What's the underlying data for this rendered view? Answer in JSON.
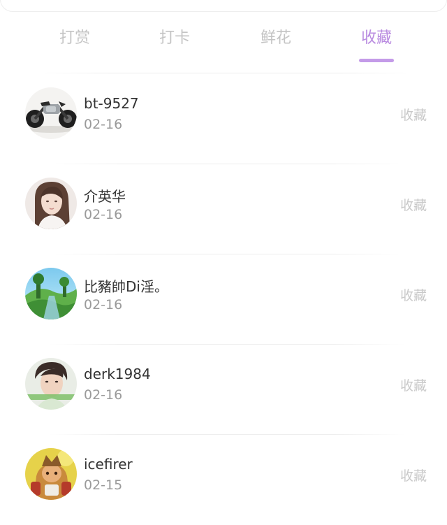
{
  "tabs": [
    {
      "label": "打赏"
    },
    {
      "label": "打卡"
    },
    {
      "label": "鲜花"
    },
    {
      "label": "收藏"
    }
  ],
  "active_tab_index": 3,
  "accent_color": "#b98be0",
  "items": [
    {
      "name": "bt-9527",
      "date": "02-16",
      "action": "收藏",
      "avatar": "motorcycle"
    },
    {
      "name": "介英华",
      "date": "02-16",
      "action": "收藏",
      "avatar": "girl-portrait"
    },
    {
      "name": "比豬帥Di淫。",
      "date": "02-16",
      "action": "收藏",
      "avatar": "landscape"
    },
    {
      "name": "derk1984",
      "date": "02-16",
      "action": "收藏",
      "avatar": "man-portrait"
    },
    {
      "name": "icefirer",
      "date": "02-15",
      "action": "收藏",
      "avatar": "game-character"
    }
  ]
}
